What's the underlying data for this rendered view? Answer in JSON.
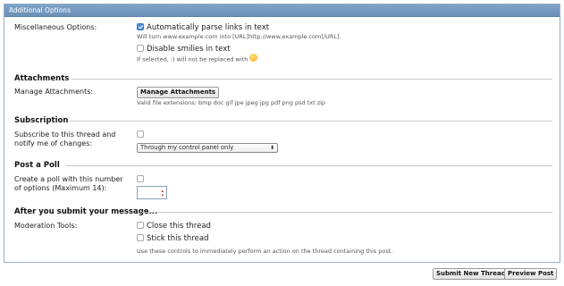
{
  "panel": {
    "title": "Additional Options"
  },
  "misc": {
    "label": "Miscellaneous Options:",
    "parse_links": {
      "label": "Automatically parse links in text",
      "checked": true,
      "hint": "Will turn www.example.com into [URL]http://www.example.com[/URL]."
    },
    "disable_smilies": {
      "label": "Disable smilies in text",
      "checked": false,
      "hint": "If selected, :) will not be replaced with"
    }
  },
  "attachments": {
    "title": "Attachments",
    "label": "Manage Attachments:",
    "button": "Manage Attachments",
    "hint": "Valid file extensions: bmp doc gif jpe jpeg jpg pdf png psd txt zip"
  },
  "subscription": {
    "title": "Subscription",
    "label": "Subscribe to this thread and notify me of changes:",
    "checked": false,
    "select_value": "Through my control panel only"
  },
  "poll": {
    "title": "Post a Poll",
    "label": "Create a poll with this number of options (Maximum 14):",
    "checked": false,
    "value": ""
  },
  "after_submit": {
    "title": "After you submit your message...",
    "label": "Moderation Tools:",
    "close": {
      "label": "Close this thread",
      "checked": false
    },
    "stick": {
      "label": "Stick this thread",
      "checked": false
    },
    "hint": "Use these controls to immediately perform an action on the thread containing this post."
  },
  "actions": {
    "submit": "Submit New Thread",
    "preview": "Preview Post"
  }
}
